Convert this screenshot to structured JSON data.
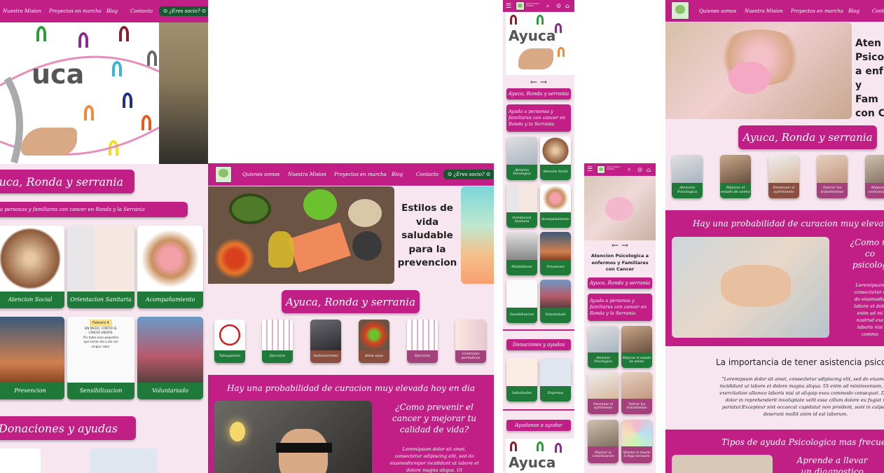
{
  "nav": {
    "quienes": "Quienes somos",
    "mision": "Nuestra Mision",
    "proyectos": "Proyectos en marcha",
    "blog": "Blog",
    "contacto": "Contacto",
    "socio": "¿Eres socio?",
    "brand_small": "Ayuca, Ronda y serrania"
  },
  "logo_text": "Ayuca",
  "hero_logo_text": "uca",
  "mobile_logo_text": "Ayuca",
  "title": "Ayuca, Ronda y serrania",
  "subtitle": "Ayuda a personas y familiares con cancer en Ronda y la Serrania",
  "subtitle_left": "a personas y familiares con cancer en Ronda y la Serrania",
  "mobile_subtitle": "Ayuda a personas y familiares con cancer en Ronda y la Serrania",
  "tablet_hero_caption": "Atencion Psicologica a enfermos y Familiares con Cancer",
  "main_cards": [
    "Atencion Social",
    "Orientacion Sanitaria",
    "Acompañamiento",
    "Prevencion",
    "Sensibilizacion",
    "Voluntariado"
  ],
  "poster_title": "Febrero 4",
  "poster_lines": [
    "SIN MIEDO, CONTRA EL",
    "CÁNCER UNIDOS.",
    "Por todos esos pequeños",
    "que luchan día a día con",
    "ningún rubor."
  ],
  "mobile_cards": [
    "Atencion Psicologica",
    "Atencion Social",
    "Orientacion Sanitaria",
    "Acompañamiento",
    "Multitallores",
    "Prevencion",
    "Sensibilizacion",
    "Voluntariado"
  ],
  "donaciones": "Donaciones y ayudas",
  "donation_cards": [
    "Individuales",
    "Empresas"
  ],
  "ayudanos": "Ayudanos a ayudar",
  "hero2": {
    "title_lines": [
      "Estilos de",
      "vida",
      "saludable",
      "para la",
      "prevencion"
    ]
  },
  "prevention_items": [
    "Tabaquismo",
    "Ejercicio",
    "Sedentarismo",
    "dieta sana",
    "Ejercicio",
    "Controles periodicos"
  ],
  "probabilidad": "Hay una probabilidad de curacion muy elevada hoy en dia",
  "probabilidad_short": "Hay una probabilidad de curacion muy elevada h",
  "como_prevenir": "¿Como prevenir el cancer y mejorar tu calidad de vida?",
  "lorem_short": "Loremipsum dolor sit amet, consectetur adipiscing elit, sed do eiusmodtempor incididunt ut labore et dolore magna aliqua. Ut",
  "right_hero_lines": [
    "Aten",
    "Psico",
    "a enf",
    "y Fam",
    "con C"
  ],
  "psych_cards": [
    "Atencion Psicologica",
    "Mejorar el estado de animo",
    "Disminuir el sufrimiento",
    "Tolerar los tratamientos",
    "Mejorar la comunicacion"
  ],
  "tablet_psych_cards": [
    "Atencion Psicologica",
    "Mejorar el estado de animo",
    "Disminuir el sufrimiento",
    "Tolerar los tratamientos",
    "Mejorar la comunicacion",
    "Afrontar la muerte si llega necesario"
  ],
  "right_como": [
    "¿Como m",
    "co",
    "psicolog"
  ],
  "right_lorem": [
    "Loremipsum",
    "consectetur a",
    "do eiusmodte",
    "labore et dolo",
    "enim ad mi",
    "nostrud exe",
    "laboris nisi",
    "commo"
  ],
  "importancia": "La importancia de tener asistencia psicolo",
  "quote": "\"Loremipsum dolor sit amet, consectetur adipiscing elit, sed do eiusmod incididunt ut labore et dolore magna aliqua. Ut enim ad minimveniam, qui exercitation ullamco laboris nisi ut aliquip exea commodo consequat. Duis dolor in reprehenderit involuptate velit esse cillum dolore eu fugiat n pariatur.Excepteur sint occaecat cupidatat non proident, sunt in culpa q deserunt mollit anim id est laborum.",
  "tipos": "Tipos de ayuda Psicologica mas frecuent",
  "aprende": "Aprende a llevar un diagnostico",
  "arrows": "← →",
  "colors": {
    "magenta": "#c21f86",
    "green": "#17592e",
    "card_green": "#1f7a3a",
    "pale": "#f7e6ef"
  }
}
